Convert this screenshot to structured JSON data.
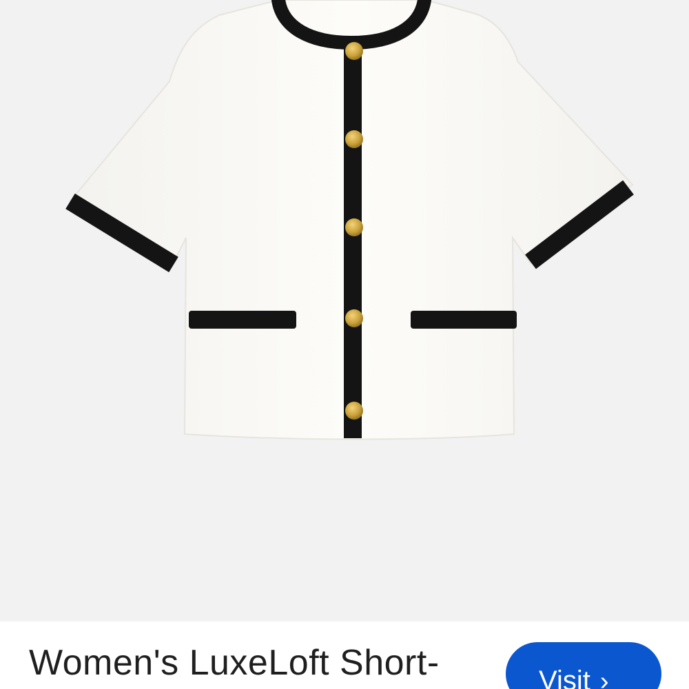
{
  "product": {
    "image_alt": "White short-sleeve cardigan with black trim and gold buttons",
    "title": "Women's LuxeLoft Short-"
  },
  "actions": {
    "visit_label": "Visit",
    "visit_icon": "chevron-right-icon"
  },
  "colors": {
    "image_background": "#f2f2f2",
    "garment": "#fbfaf6",
    "trim": "#141414",
    "button_gold": "#c9a23a",
    "visit_button": "#0b57d0"
  }
}
